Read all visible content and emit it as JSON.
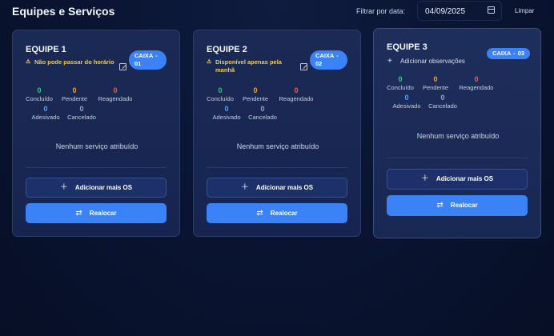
{
  "header": {
    "title": "Equipes e Serviços",
    "filter_label": "Filtrar por data:",
    "date_value": "04/09/2025",
    "clear_label": "Limpar"
  },
  "icons": {
    "calendar": "calendar-icon",
    "warning": "warning-icon",
    "edit": "edit-icon",
    "plus": "plus-icon",
    "swap": "swap-icon"
  },
  "colors": {
    "accent": "#3b82f6",
    "warning": "#f2c94c",
    "concluido": "#2ecc71",
    "pendente": "#f5a524",
    "reagendado": "#ef5b5b",
    "adesivado": "#4da3ff",
    "cancelado": "#9aa6bd"
  },
  "teams": [
    {
      "name": "EQUIPE 1",
      "note": "Não pode passar do horário",
      "box": "CAIXA - 01",
      "stats": {
        "concluido": "0",
        "pendente": "0",
        "reagendado": "0",
        "adesivado": "0",
        "cancelado": "0"
      },
      "empty": "Nenhum serviço atribuído",
      "add_label": "Adicionar mais OS",
      "move_label": "Realocar"
    },
    {
      "name": "EQUIPE 2",
      "note": "Disponível apenas pela manhã",
      "box": "CAIXA - 02",
      "stats": {
        "concluido": "0",
        "pendente": "0",
        "reagendado": "0",
        "adesivado": "0",
        "cancelado": "0"
      },
      "empty": "Nenhum serviço atribuído",
      "add_label": "Adicionar mais OS",
      "move_label": "Realocar"
    },
    {
      "name": "EQUIPE 3",
      "add_note": "Adicionar observações",
      "box": "CAIXA - 03",
      "stats": {
        "concluido": "0",
        "pendente": "0",
        "reagendado": "0",
        "adesivado": "0",
        "cancelado": "0"
      },
      "empty": "Nenhum serviço atribuído",
      "add_label": "Adicionar mais OS",
      "move_label": "Realocar"
    }
  ],
  "stat_labels": {
    "concluido": "Concluído",
    "pendente": "Pendente",
    "reagendado": "Reagendado",
    "adesivado": "Adesivado",
    "cancelado": "Cancelado"
  }
}
